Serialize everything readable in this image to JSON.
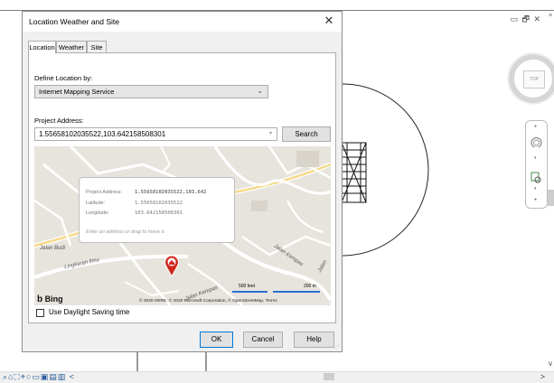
{
  "dialog": {
    "title": "Location Weather and Site",
    "close_glyph": "✕",
    "tabs": [
      {
        "label": "Location",
        "active": true
      },
      {
        "label": "Weather",
        "active": false
      },
      {
        "label": "Site",
        "active": false
      }
    ],
    "define_label": "Define Location by:",
    "define_value": "Internet Mapping Service",
    "address_label": "Project Address:",
    "address_value": "1.55658102035522,103.642158508301",
    "search_label": "Search",
    "popup": {
      "address_key": "Project Address:",
      "address_value": "1.55658102035522,103.642",
      "latitude_key": "Latitude:",
      "latitude_value": "1.55658102035522",
      "longitude_key": "Longitude:",
      "longitude_value": "103.642158508301",
      "hint": "Enter an address or drag to move it."
    },
    "map_labels": {
      "road_1": "Jalan Budi",
      "road_2": "Lingkaran Ilmu",
      "road_3": "Jalan Kempas",
      "road_4": "Jalan Kempas",
      "road_5": "Jalan"
    },
    "bing_label": "Bing",
    "scale_feet": "500 feet",
    "scale_m": "200 m",
    "attribution": "© 2020 HERE, © 2020 Microsoft Corporation, © OpenStreetMap, Terms",
    "dst_label": "Use Daylight Saving time",
    "dst_checked": false,
    "ok_label": "OK",
    "cancel_label": "Cancel",
    "help_label": "Help"
  },
  "host": {
    "window_controls": "▭ 🗗 ✕",
    "viewcube_face": "TOP",
    "scroll_up": "^",
    "scroll_down": "v",
    "hscroll_right": ">",
    "status_icons": "⌕⌂⛶⌖○▭▣▤▥ <"
  },
  "colors": {
    "accent_blue": "#0078d7",
    "pin_red": "#d0281f",
    "map_bg": "#e7e4dd"
  }
}
